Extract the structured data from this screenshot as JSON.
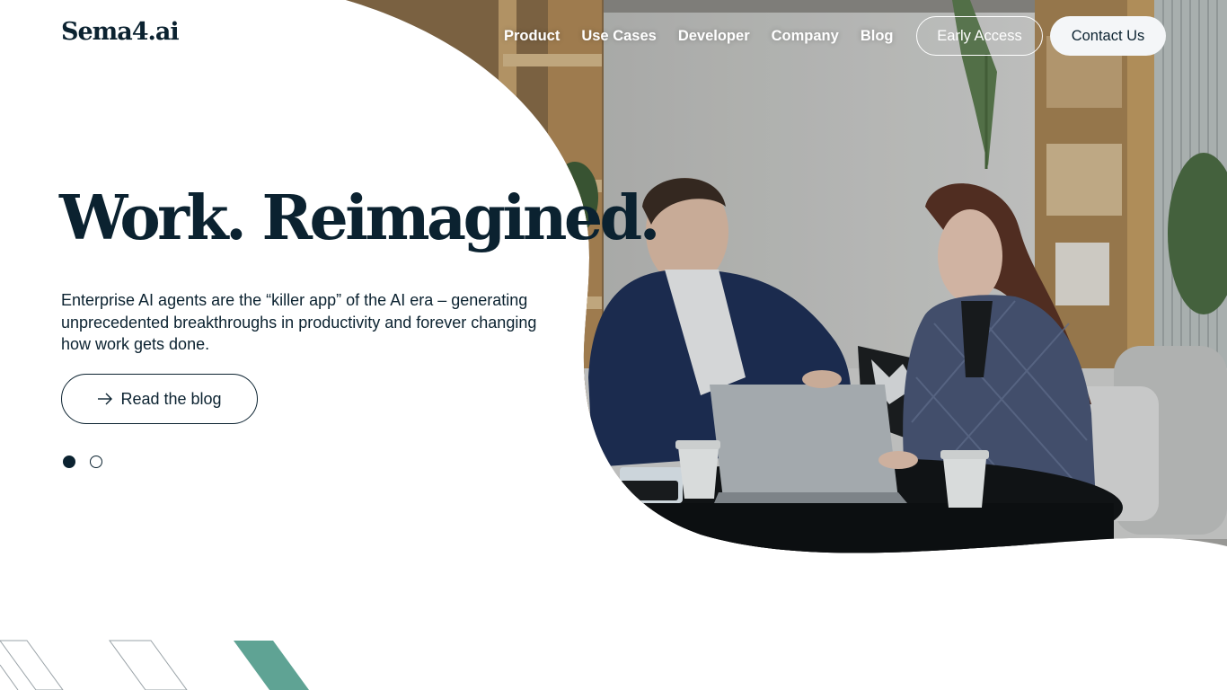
{
  "header": {
    "logo_text": "Sema4.ai",
    "nav": [
      {
        "label": "Product"
      },
      {
        "label": "Use Cases"
      },
      {
        "label": "Developer"
      },
      {
        "label": "Company"
      },
      {
        "label": "Blog"
      }
    ],
    "early_access_label": "Early Access",
    "contact_label": "Contact Us"
  },
  "hero": {
    "title": "Work. Reimagined.",
    "description": "Enterprise AI agents are the “killer app” of the AI era – generating unprecedented breakthroughs in productivity and forever changing how work gets done.",
    "cta_label": "Read the blog",
    "cta_icon": "arrow-right-icon",
    "slides": {
      "count": 2,
      "active_index": 0
    },
    "photo": "two-colleagues-at-laptop-photo"
  },
  "colors": {
    "brand_dark": "#0b2230",
    "accent_teal": "#5fa394",
    "stripe_gray": "#9aa3a8",
    "button_light": "#f4f6f8"
  }
}
